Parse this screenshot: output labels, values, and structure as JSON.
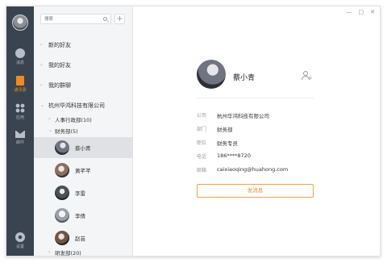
{
  "rail": {
    "items": [
      {
        "label": "消息",
        "icon": "chat-icon"
      },
      {
        "label": "通讯录",
        "icon": "contacts-icon",
        "active": true
      },
      {
        "label": "应用",
        "icon": "apps-icon"
      },
      {
        "label": "邮件",
        "icon": "mail-icon"
      }
    ],
    "settings_label": "设置"
  },
  "search": {
    "placeholder": "搜索"
  },
  "add_button": "+",
  "groups": {
    "new_friends": "新的好友",
    "my_friends": "我的好友",
    "my_groups": "我的群聊",
    "company": "杭州华鸿科技有限公司"
  },
  "departments": {
    "hr_admin": "人事行政部(10)",
    "finance": "财务部(5)",
    "rnd": "研发部(20)"
  },
  "contacts": [
    "蔡小青",
    "黄芊芊",
    "李雷",
    "李倩",
    "赵芸"
  ],
  "window_controls": {
    "minimize": "—",
    "maximize": "□",
    "close": "✕"
  },
  "profile": {
    "name": "蔡小青",
    "fields": [
      {
        "label": "公司",
        "value": "杭州华鸿科技有限公司"
      },
      {
        "label": "部门",
        "value": "财务部"
      },
      {
        "label": "职位",
        "value": "财务专员"
      },
      {
        "label": "电话",
        "value": "186****8720"
      },
      {
        "label": "邮箱",
        "value": "caixiaoqing@huahong.com"
      }
    ],
    "send_message": "发消息"
  },
  "colors": {
    "accent": "#f08a24",
    "rail_bg": "#3a4450",
    "list_bg": "#f4f5f7",
    "selected_bg": "#dfe1e4"
  }
}
